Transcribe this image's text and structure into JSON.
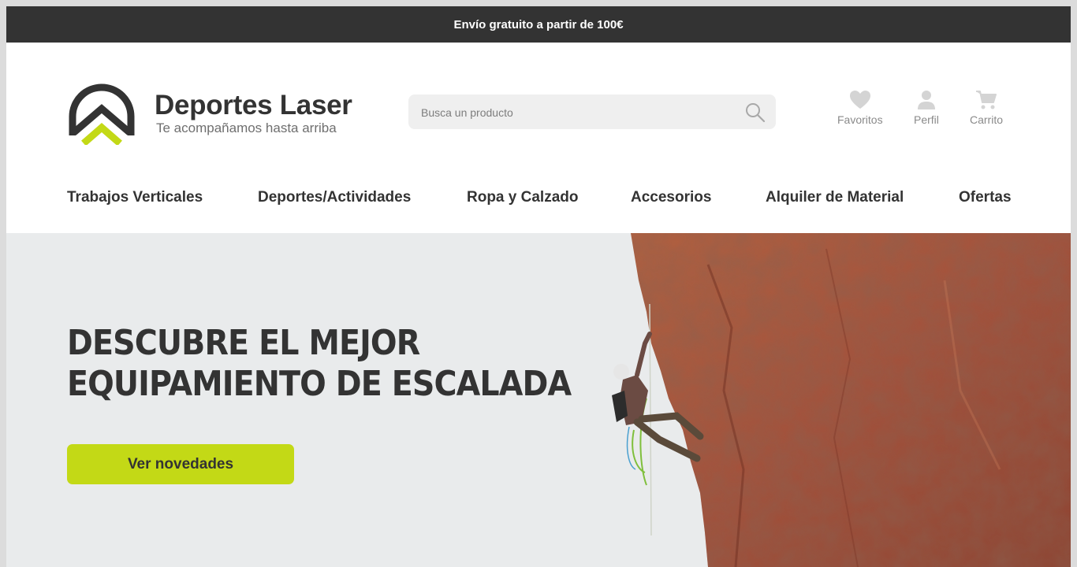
{
  "promo": {
    "text": "Envío gratuito a partir de 100€"
  },
  "brand": {
    "name": "Deportes Laser",
    "tagline": "Te acompañamos hasta arriba"
  },
  "search": {
    "placeholder": "Busca un producto",
    "icon": "search-icon"
  },
  "actions": [
    {
      "label": "Favoritos",
      "icon": "heart-icon"
    },
    {
      "label": "Perfil",
      "icon": "user-icon"
    },
    {
      "label": "Carrito",
      "icon": "cart-icon"
    }
  ],
  "nav": [
    {
      "label": "Trabajos Verticales"
    },
    {
      "label": "Deportes/Actividades"
    },
    {
      "label": "Ropa y Calzado"
    },
    {
      "label": "Accesorios"
    },
    {
      "label": "Alquiler de Material"
    },
    {
      "label": "Ofertas"
    }
  ],
  "hero": {
    "title_line1": "DESCUBRE EL MEJOR",
    "title_line2": "EQUIPAMIENTO DE ESCALADA",
    "cta_label": "Ver novedades",
    "image": "climber-on-rock-wall-photo"
  },
  "colors": {
    "accent": "#c3d916",
    "dark": "#333333",
    "hero_bg": "#e9ebec",
    "rock": "#a9553a"
  }
}
